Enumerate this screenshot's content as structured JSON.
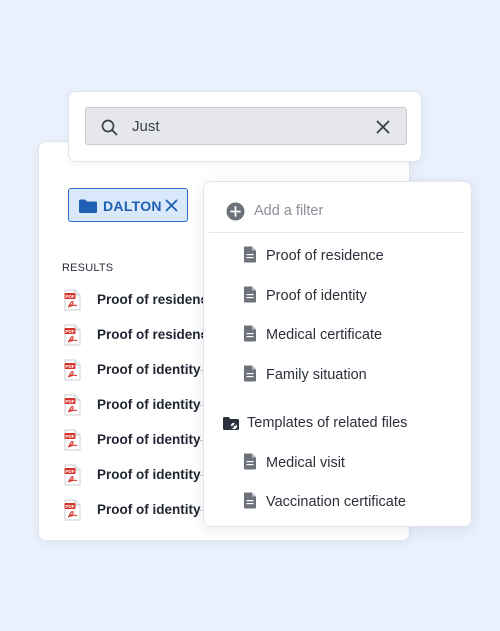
{
  "search": {
    "query": "Just"
  },
  "chip": {
    "label": "DALTON"
  },
  "results": {
    "header": "RESULTS",
    "items": [
      "Proof of residence",
      "Proof of residence",
      "Proof of identity",
      "Proof of identity",
      "Proof of identity",
      "Proof of identity",
      "Proof of identity"
    ]
  },
  "filter": {
    "add_label": "Add a filter",
    "items": [
      "Proof of residence",
      "Proof of identity",
      "Medical certificate",
      "Family situation"
    ],
    "section_label": "Templates of related files",
    "section_items": [
      "Medical visit",
      "Vaccination certificate"
    ]
  },
  "colors": {
    "accent": "#2a6fc9",
    "chip_bg": "#d9e8fb",
    "pdf_red": "#d6332a",
    "background": "#eaf0fc"
  }
}
